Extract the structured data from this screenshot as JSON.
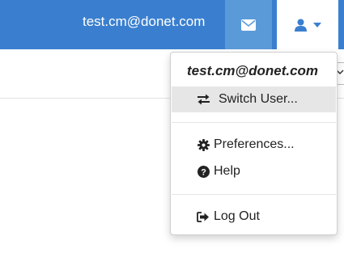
{
  "header": {
    "user_email": "test.cm@donet.com",
    "mail_icon": "envelope-icon",
    "user_icon": "user-icon",
    "caret_icon": "caret-down-icon"
  },
  "dropdown": {
    "header": "test.cm@donet.com",
    "items": [
      {
        "label": "Switch User...",
        "icon": "exchange-icon"
      },
      {
        "label": "Preferences...",
        "icon": "gear-icon"
      },
      {
        "label": "Help",
        "icon": "question-circle-icon"
      },
      {
        "label": "Log Out",
        "icon": "sign-out-icon"
      }
    ]
  },
  "colors": {
    "topbar": "#3a7fcf",
    "mail_button": "#5b9ad8",
    "accent_icon": "#3a7fcf",
    "hover": "#e6e6e6"
  }
}
